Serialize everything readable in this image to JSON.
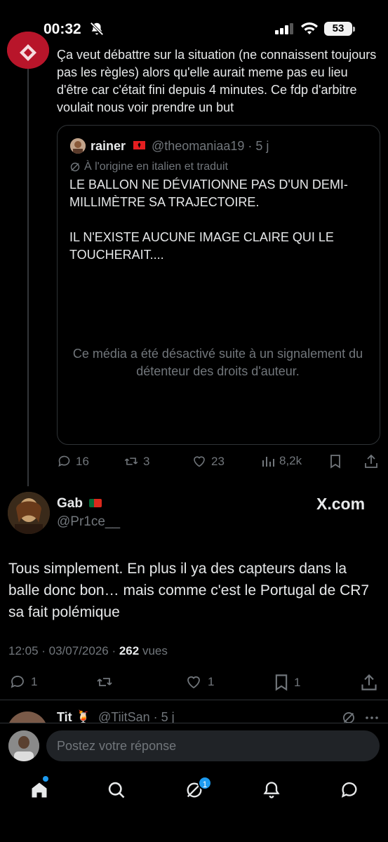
{
  "status_bar": {
    "time": "00:32",
    "battery": "53"
  },
  "parent_post": {
    "text": "Ça veut débattre sur la situation (ne connaissent toujours pas les règles) alors qu'elle aurait meme pas eu lieu d'être car c'était fini depuis 4 minutes. Ce fdp d'arbitre voulait nous voir prendre un but",
    "quote": {
      "name": "rainer",
      "handle_time": "@theomaniaa19 · 5 j",
      "translated_note": "À l'origine en italien et traduit",
      "text": "LE BALLON NE DÉVIATIONNE PAS D'UN DEMI-MILLIMÈTRE SA TRAJECTOIRE.\n\nIL N'EXISTE AUCUNE IMAGE CLAIRE QUI LE TOUCHERAIT....",
      "media_disabled": "Ce média a été désactivé suite à un signalement du détenteur des droits d'auteur."
    },
    "actions": {
      "replies": "16",
      "reposts": "3",
      "likes": "23",
      "views": "8,2k"
    }
  },
  "main_post": {
    "name": "Gab",
    "handle": "@Pr1ce__",
    "brand": "X.com",
    "text": "Tous simplement. En plus il ya des capteurs dans la balle donc bon… mais comme c'est le Portugal de CR7 sa fait polémique",
    "timestamp": "12:05 · 03/07/2026 · ",
    "views_count": "262",
    "views_label": " vues",
    "actions": {
      "replies": "1",
      "likes": "1",
      "bookmarks": "1"
    }
  },
  "next_reply": {
    "name": "Tit",
    "handle_time": "@TiitSan · 5 j"
  },
  "composer": {
    "placeholder": "Postez votre réponse"
  },
  "nav": {
    "messages_badge": "1"
  },
  "colors": {
    "background": "#000000",
    "text": "#e7e9ea",
    "muted": "#71767b",
    "accent": "#1d9bf0",
    "border": "#2f3336"
  }
}
